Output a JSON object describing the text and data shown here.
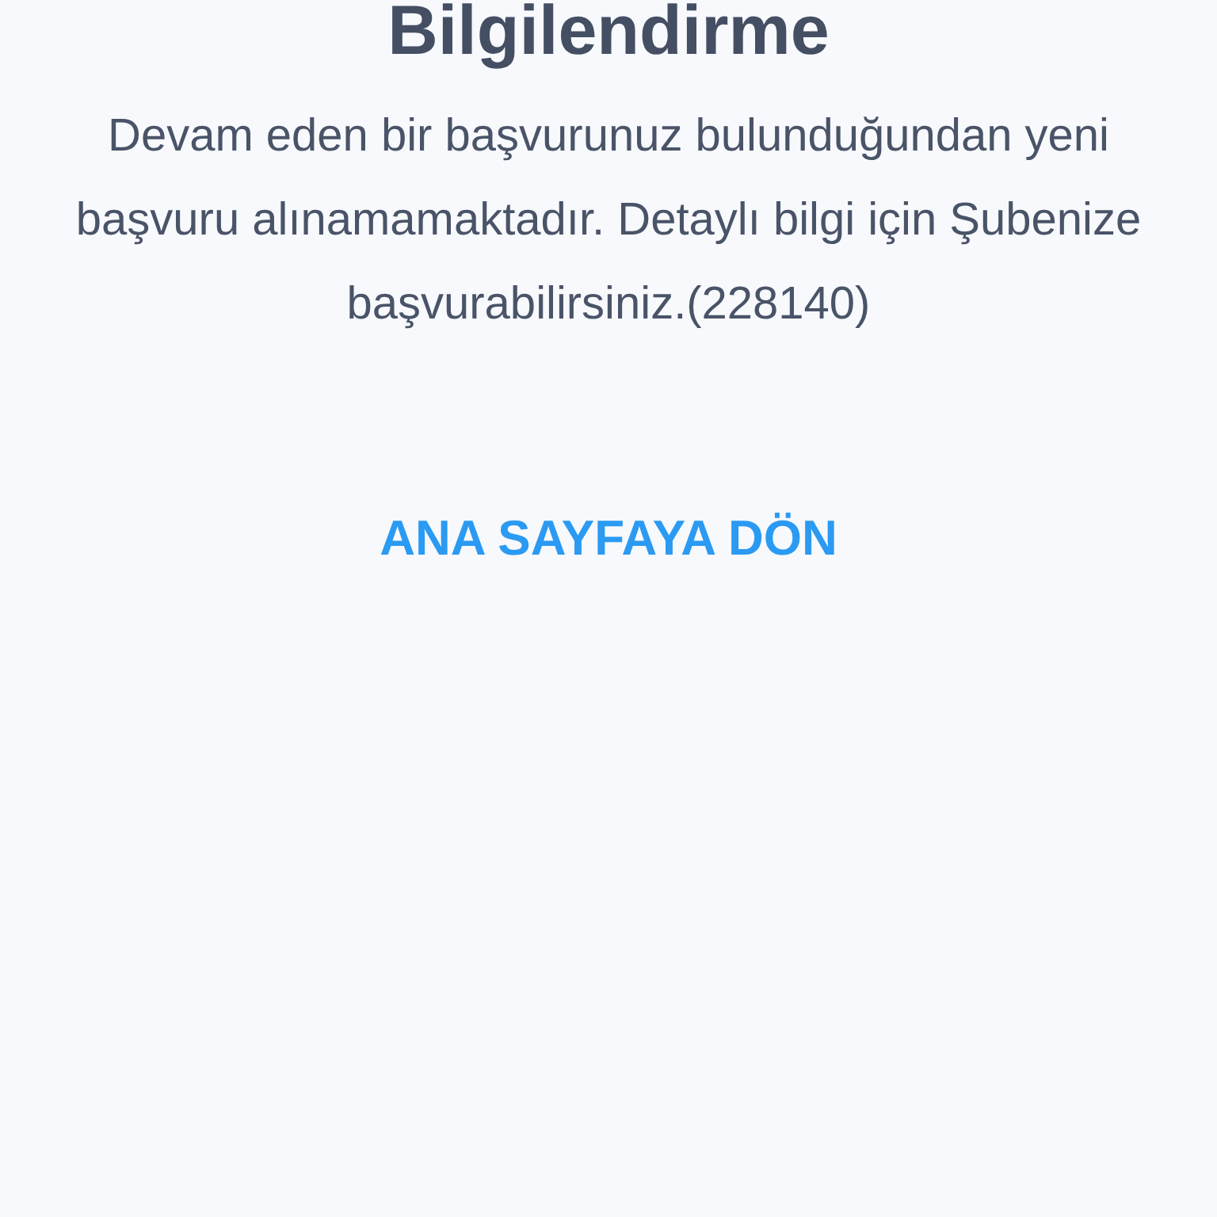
{
  "title": "Bilgilendirme",
  "message": "Devam eden bir başvurunuz bulunduğundan yeni başvuru alınamamaktadır. Detaylı bilgi için Şubenize başvurabilirsiniz.(228140)",
  "button": {
    "label": "ANA SAYFAYA DÖN"
  }
}
